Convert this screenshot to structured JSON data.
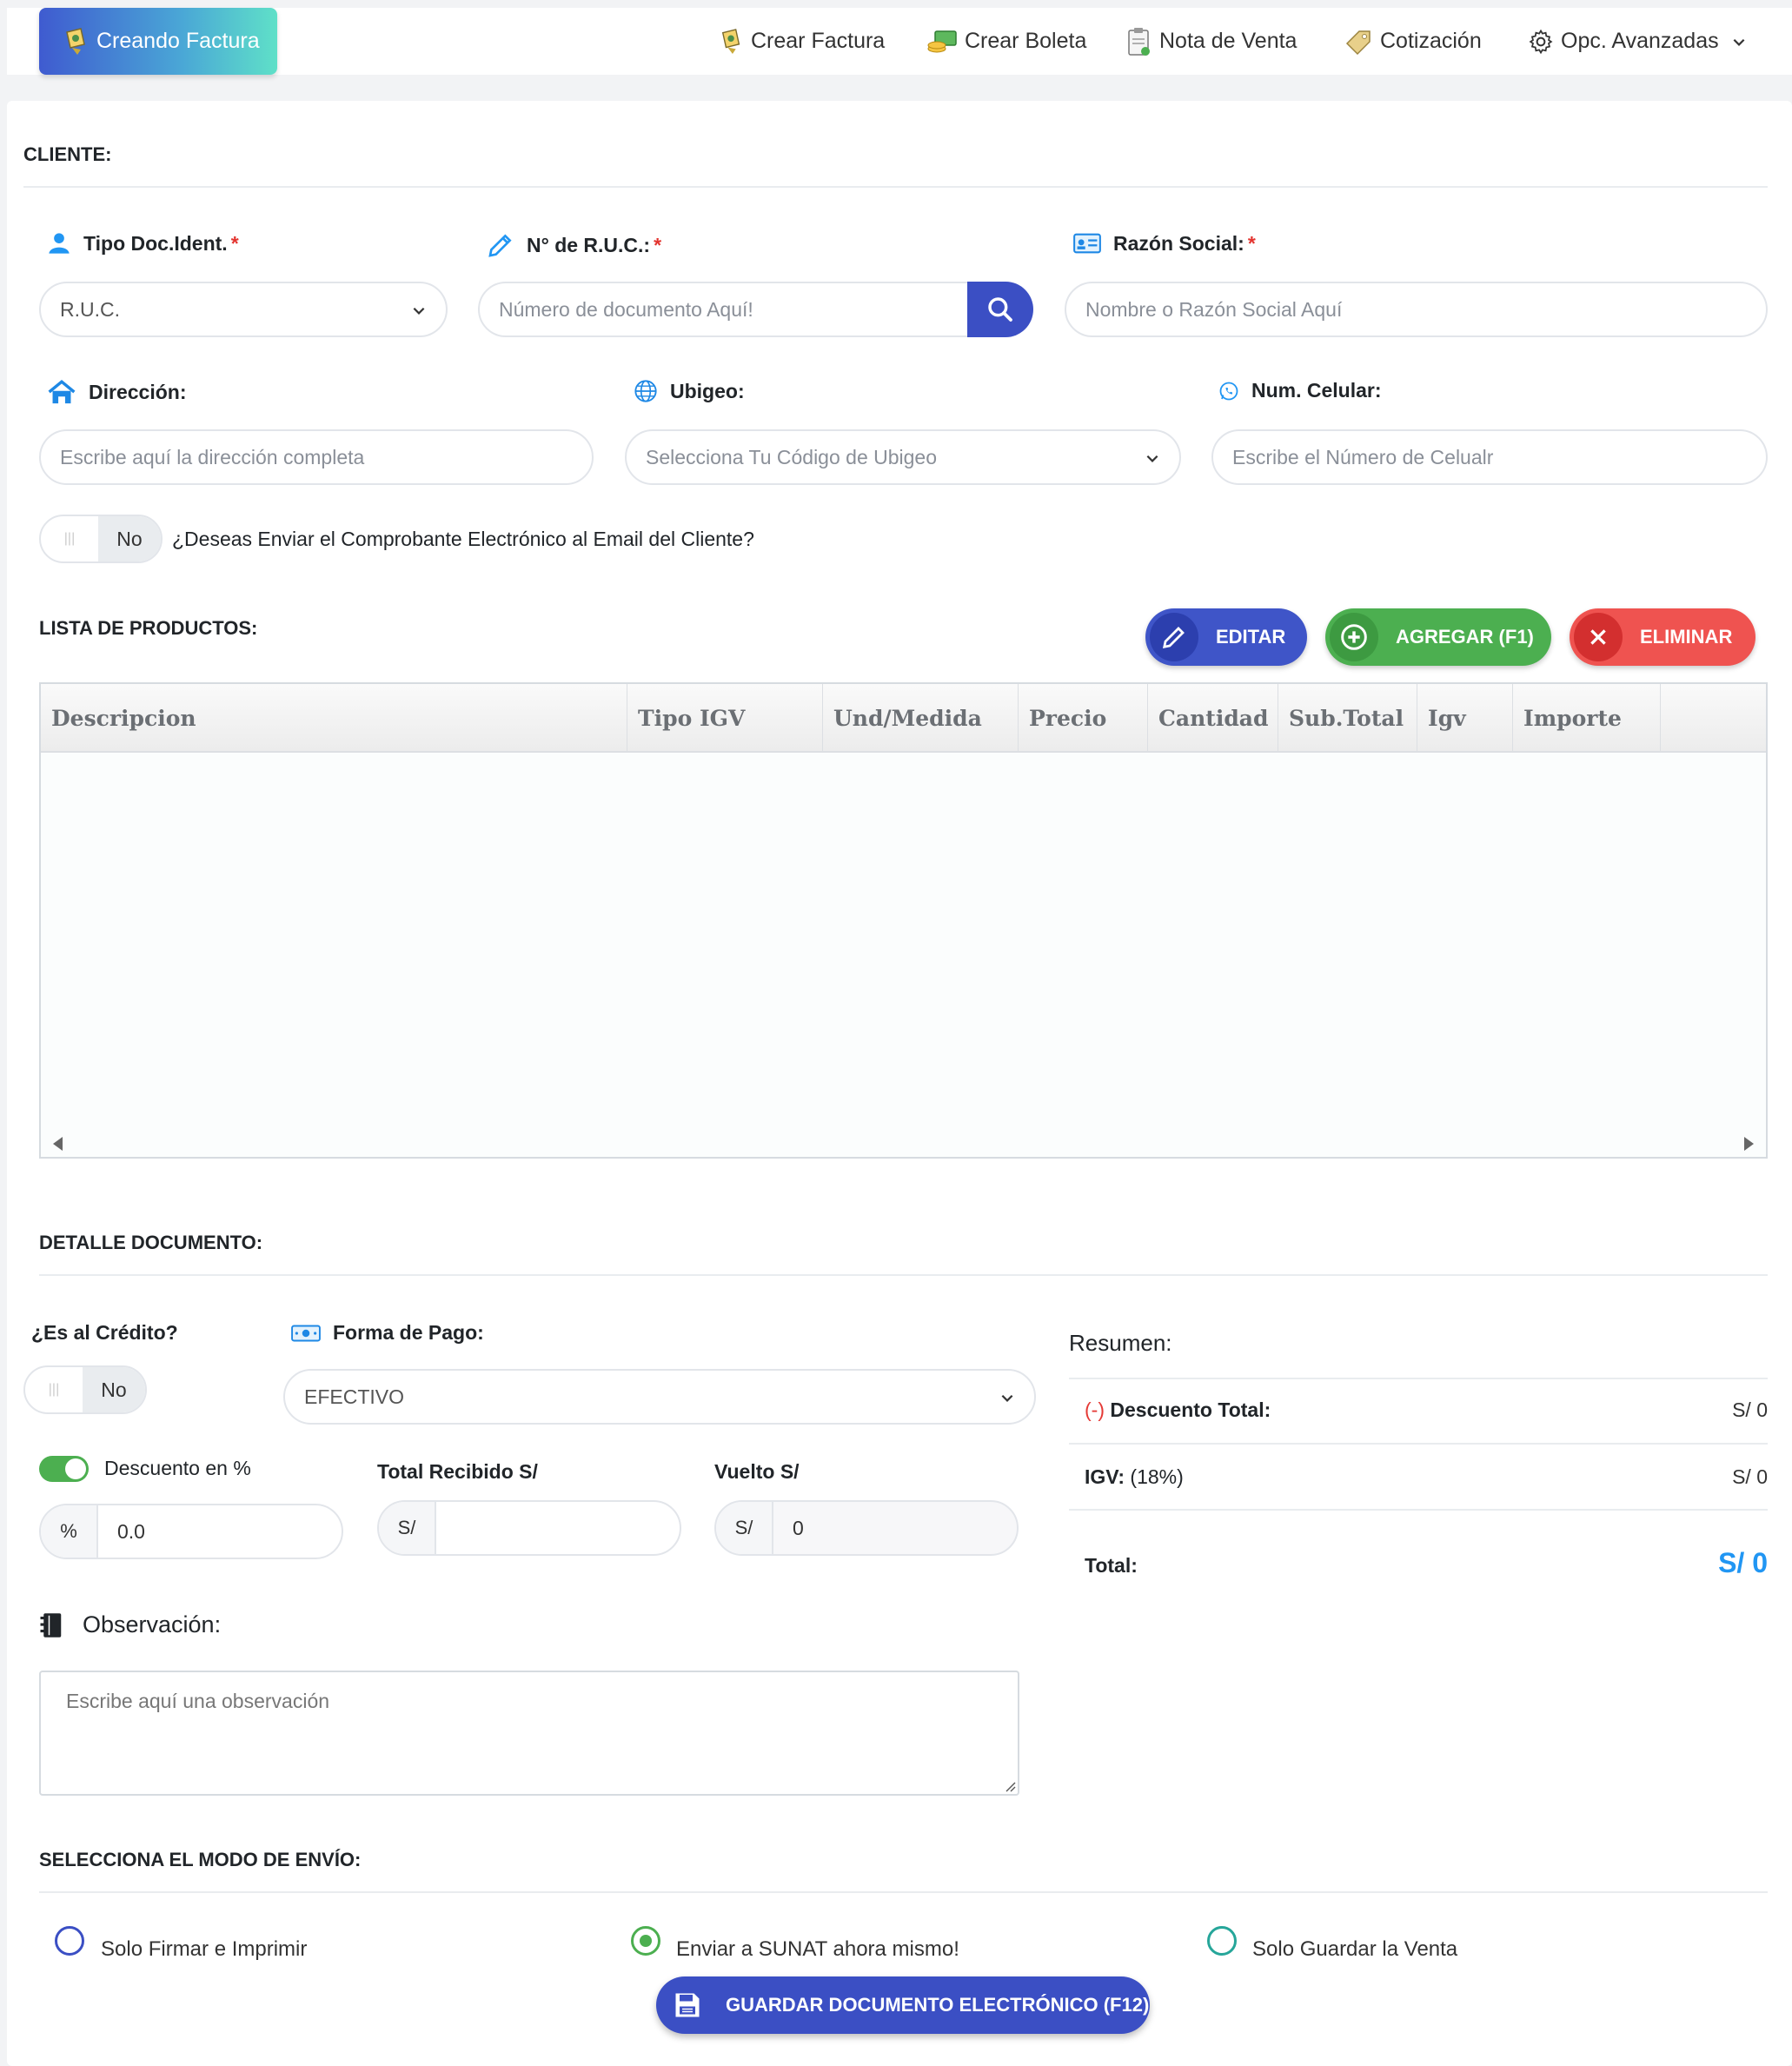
{
  "nav": {
    "brand": "Creando Factura",
    "items": [
      "Crear Factura",
      "Crear Boleta",
      "Nota de Venta",
      "Cotización",
      "Opc. Avanzadas"
    ]
  },
  "cliente": {
    "title": "CLIENTE:",
    "tipo_doc_label": "Tipo Doc.Ident.",
    "tipo_doc_value": "R.U.C.",
    "ruc_label": "N° de R.U.C.:",
    "ruc_placeholder": "Número de documento Aquí!",
    "razon_label": "Razón Social:",
    "razon_placeholder": "Nombre o Razón Social Aquí",
    "direccion_label": "Dirección:",
    "direccion_placeholder": "Escribe aquí la dirección completa",
    "ubigeo_label": "Ubigeo:",
    "ubigeo_placeholder": "Selecciona Tu Código de Ubigeo",
    "celular_label": "Num. Celular:",
    "celular_placeholder": "Escribe el Número de Celualr",
    "email_toggle": "No",
    "email_question": "¿Deseas Enviar el Comprobante Electrónico al Email del Cliente?",
    "required_mark": "*"
  },
  "productos": {
    "title": "LISTA DE PRODUCTOS:",
    "edit_label": "EDITAR",
    "add_label": "AGREGAR (F1)",
    "delete_label": "ELIMINAR",
    "columns": [
      "Descripcion",
      "Tipo IGV",
      "Und/Medida",
      "Precio",
      "Cantidad",
      "Sub.Total",
      "Igv",
      "Importe"
    ]
  },
  "detalle": {
    "title": "DETALLE DOCUMENTO:",
    "credito_label": "¿Es al Crédito?",
    "credito_toggle": "No",
    "forma_pago_label": "Forma de Pago:",
    "forma_pago_value": "EFECTIVO",
    "descuento_label": "Descuento en %",
    "descuento_addon": "%",
    "descuento_value": "0.0",
    "total_recibido_label": "Total Recibido S/",
    "total_recibido_addon": "S/",
    "vuelto_label": "Vuelto S/",
    "vuelto_addon": "S/",
    "vuelto_value": "0",
    "observacion_label": "Observación:",
    "observacion_placeholder": "Escribe aquí una observación"
  },
  "resumen": {
    "title": "Resumen:",
    "descuento_prefix": "(-)",
    "descuento_label": "Descuento Total:",
    "descuento_value": "S/ 0",
    "igv_label": "IGV:",
    "igv_rate": "(18%)",
    "igv_value": "S/ 0",
    "total_label": "Total:",
    "total_value": "S/ 0"
  },
  "envio": {
    "title": "SELECCIONA EL MODO DE ENVÍO:",
    "options": [
      "Solo Firmar e Imprimir",
      "Enviar a SUNAT ahora mismo!",
      "Solo Guardar la Venta"
    ],
    "save_label": "GUARDAR DOCUMENTO ELECTRÓNICO (F12)"
  },
  "colors": {
    "primary": "#3b4fc4",
    "success": "#4caf50",
    "danger": "#e53935",
    "total": "#2196f3"
  }
}
